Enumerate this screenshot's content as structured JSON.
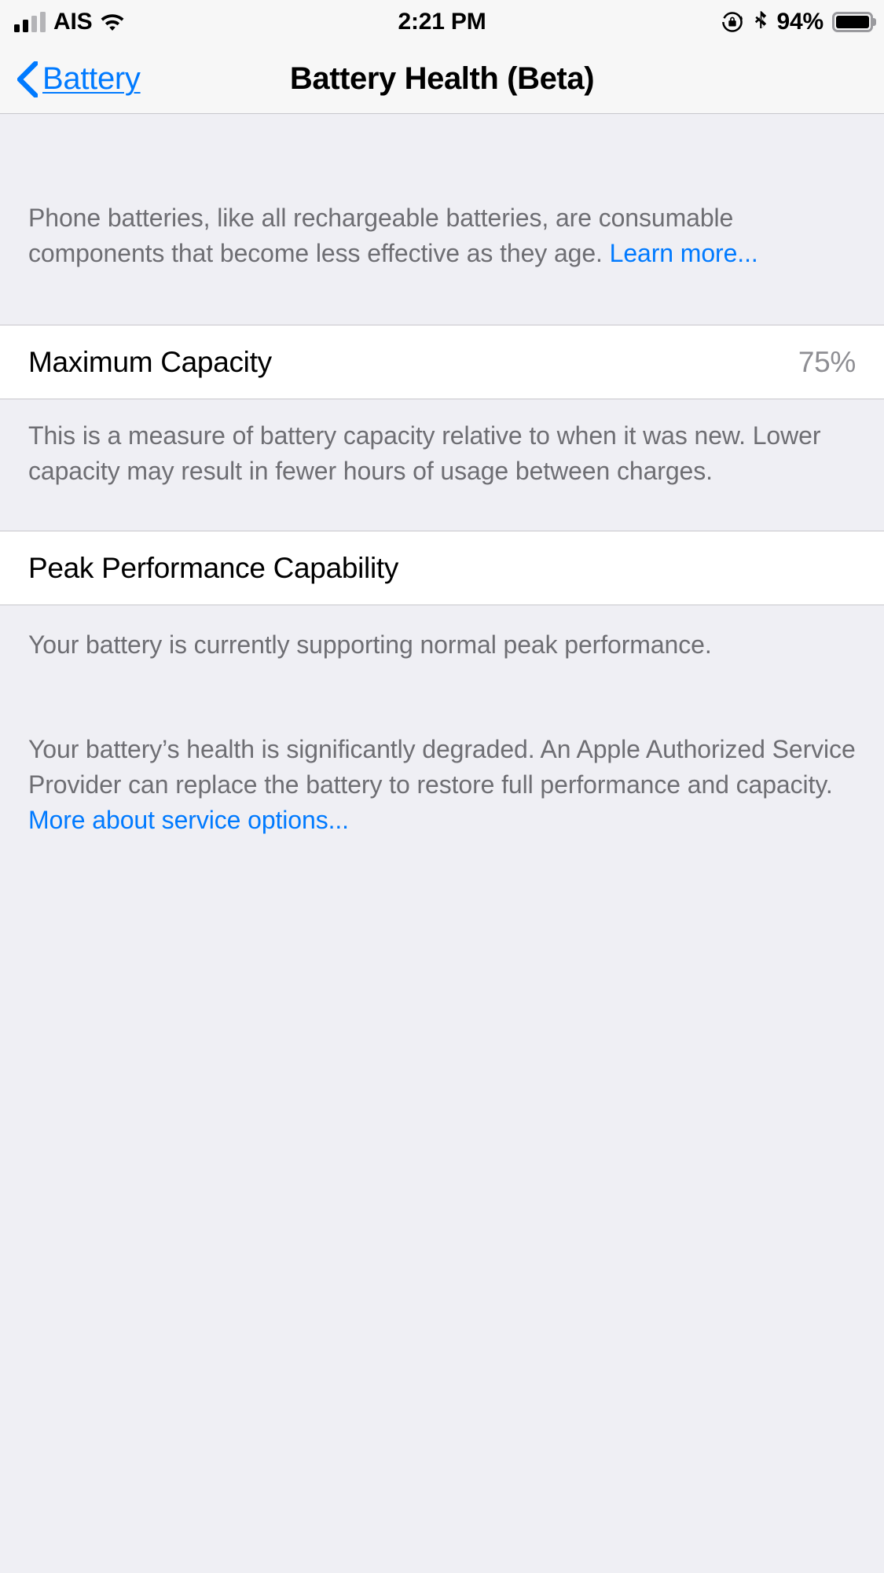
{
  "status_bar": {
    "carrier": "AIS",
    "time": "2:21 PM",
    "battery_percent": "94%",
    "icons": {
      "signal": "cellular-signal-icon",
      "wifi": "wifi-icon",
      "rotation_lock": "rotation-lock-icon",
      "bluetooth": "bluetooth-icon",
      "battery": "battery-icon"
    }
  },
  "nav_bar": {
    "back_label": "Battery",
    "title": "Battery Health (Beta)"
  },
  "intro": {
    "text": "Phone batteries, like all rechargeable batteries, are consumable components that become less effective as they age. ",
    "link": "Learn more..."
  },
  "maximum_capacity": {
    "label": "Maximum Capacity",
    "value": "75%",
    "description": "This is a measure of battery capacity relative to when it was new. Lower capacity may result in fewer hours of usage between charges."
  },
  "peak_performance": {
    "label": "Peak Performance Capability",
    "status_text": "Your battery is currently supporting normal peak performance.",
    "degraded_text": "Your battery’s health is significantly degraded. An Apple Authorized Service Provider can replace the battery to restore full performance and capacity.",
    "service_link": "More about service options..."
  },
  "colors": {
    "accent_blue": "#007aff",
    "group_background": "#efeff4",
    "cell_background": "#ffffff",
    "separator": "#c8c7cc",
    "secondary_text": "#6e6e73",
    "value_text": "#8e8e93"
  }
}
